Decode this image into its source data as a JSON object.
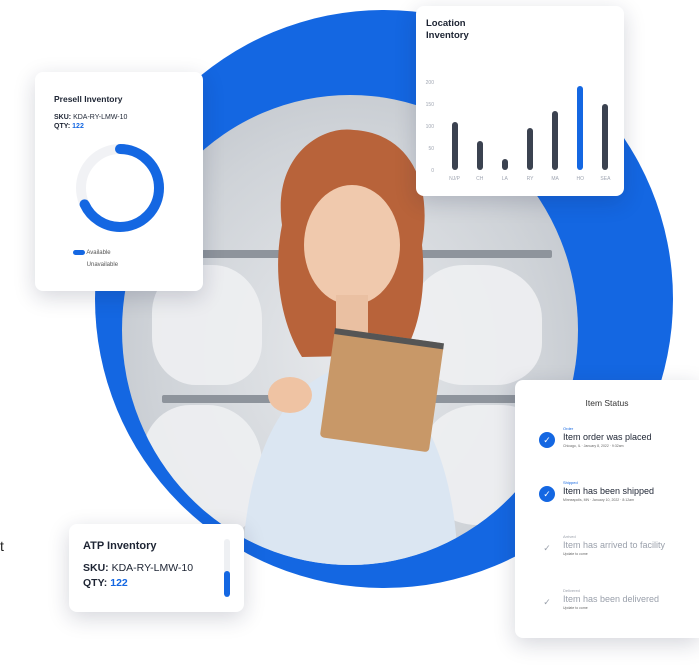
{
  "stray_text": "t",
  "presell": {
    "title": "Presell Inventory",
    "sku_label": "SKU:",
    "sku_value": "KDA-RY-LMW-10",
    "qty_label": "QTY:",
    "qty_value": "122",
    "available_fraction": 0.68,
    "legend": [
      "Available",
      "Unavailable"
    ],
    "colors": {
      "available": "#1467e2",
      "unavailable": "#f1f2f5"
    }
  },
  "location": {
    "title_line1": "Location",
    "title_line2": "Inventory",
    "chart_data": {
      "type": "bar",
      "title": "Location Inventory",
      "categories": [
        "NJ/P",
        "CH",
        "LA",
        "RY",
        "MA",
        "HO",
        "SEA"
      ],
      "values": [
        110,
        65,
        25,
        95,
        135,
        190,
        150
      ],
      "ylim": [
        0,
        200
      ],
      "yticks": [
        "200",
        "150",
        "100",
        "50",
        "0"
      ],
      "highlight_index": 5,
      "colors": {
        "bar": "#3b4250",
        "highlight": "#1467e2"
      }
    }
  },
  "atp": {
    "title": "ATP Inventory",
    "sku_label": "SKU:",
    "sku_value": "KDA-RY-LMW-10",
    "qty_label": "QTY:",
    "qty_value": "122",
    "level_fraction": 0.45
  },
  "status": {
    "title": "Item Status",
    "items": [
      {
        "stage": "Order",
        "title": "Item order was placed",
        "sub": "Chicago, IL · January 8, 2022 · 9:32am",
        "done": true
      },
      {
        "stage": "Shipped",
        "title": "Item has been shipped",
        "sub": "Minneapolis, MN · January 10, 2022 · 8:12am",
        "done": true
      },
      {
        "stage": "Arrived",
        "title": "Item has arrived to facility",
        "sub": "Update to come",
        "done": false
      },
      {
        "stage": "Delivered",
        "title": "Item has been delivered",
        "sub": "Update to come",
        "done": false
      }
    ]
  }
}
